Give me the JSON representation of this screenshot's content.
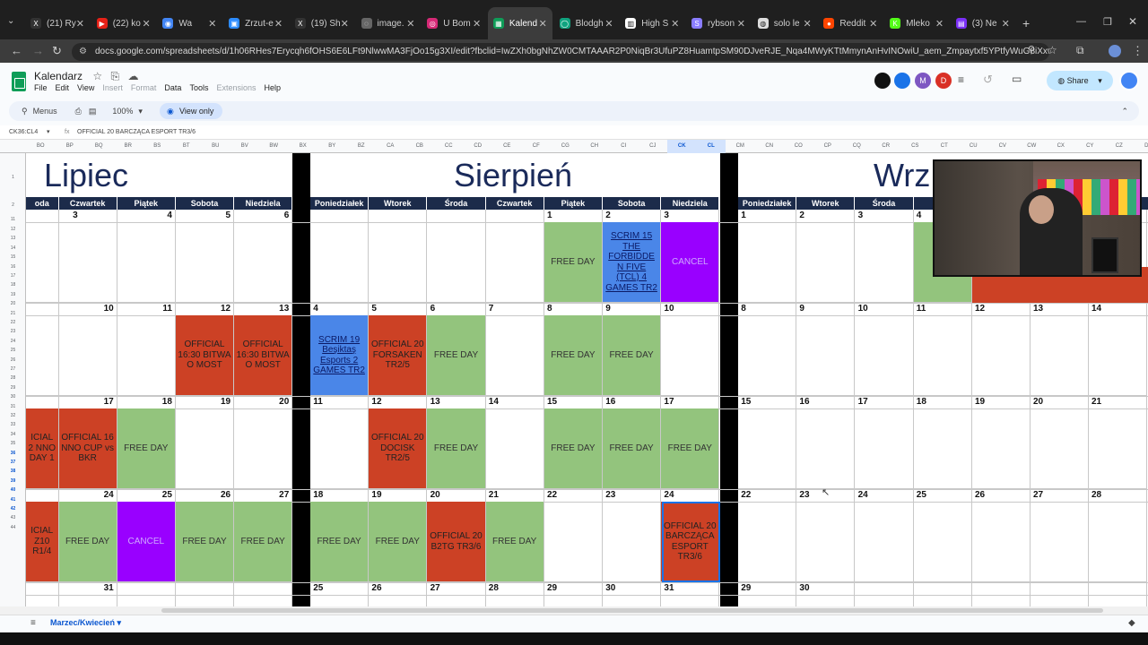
{
  "browser": {
    "tabs": [
      {
        "label": "(21) Ry",
        "color": "#333333",
        "glyph": "X"
      },
      {
        "label": "(22) ko",
        "color": "#e62117",
        "glyph": "▶"
      },
      {
        "label": "Wa",
        "color": "#4285f4",
        "glyph": "◉"
      },
      {
        "label": "Zrzut-e",
        "color": "#2d8cff",
        "glyph": "▣"
      },
      {
        "label": "(19) Sh",
        "color": "#333333",
        "glyph": "X"
      },
      {
        "label": "image.",
        "color": "#666666",
        "glyph": "◌"
      },
      {
        "label": "U Bom",
        "color": "#d62976",
        "glyph": "◎"
      },
      {
        "label": "Kalend",
        "color": "#0f9d58",
        "glyph": "▦",
        "active": true
      },
      {
        "label": "Blodgh",
        "color": "#10a37f",
        "glyph": "◯"
      },
      {
        "label": "High S",
        "color": "#ffffff",
        "glyph": "▥"
      },
      {
        "label": "rybson",
        "color": "#8a7dff",
        "glyph": "S"
      },
      {
        "label": "solo le",
        "color": "#dddddd",
        "glyph": "◍"
      },
      {
        "label": "Reddit",
        "color": "#ff4500",
        "glyph": "●"
      },
      {
        "label": "Mleko",
        "color": "#53fc18",
        "glyph": "K"
      },
      {
        "label": "(3) Ne",
        "color": "#7b2ff7",
        "glyph": "▤"
      }
    ],
    "url": "docs.google.com/spreadsheets/d/1h06RHes7Erycqh6fOHS6E6LFt9NlwwMA3FjOo15g3XI/edit?fbclid=IwZXh0bgNhZW0CMTAAAR2P0NiqBr3UfuPZ8HuamtpSM90DJveRJE_Nqa4MWyKTtMmynAnHvINOwiU_aem_Zmpaytxf5YPtfyWuG8iXxw&gid=11984..."
  },
  "sheets": {
    "title": "Kalendarz",
    "menu": [
      "File",
      "Edit",
      "View",
      "Insert",
      "Format",
      "Data",
      "Tools",
      "Extensions",
      "Help"
    ],
    "menu_dim": [
      false,
      false,
      false,
      true,
      true,
      false,
      false,
      true,
      false
    ],
    "menus_search": "Menus",
    "zoom": "100%",
    "view_only": "View only",
    "share": "Share",
    "avatars": [
      {
        "letter": "",
        "color": "#111111"
      },
      {
        "letter": "",
        "color": "#1a73e8"
      },
      {
        "letter": "M",
        "color": "#7e57c2"
      },
      {
        "letter": "D",
        "color": "#d93025"
      }
    ],
    "cell_ref": "CK36:CL4",
    "formula": "OFFICIAL 20 BARCZĄCA ESPORT TR3/6",
    "sheet_tab": "Marzec/Kwiecień"
  },
  "columns": [
    "BO",
    "BP",
    "BQ",
    "BR",
    "BS",
    "BT",
    "BU",
    "BV",
    "BW",
    "BX",
    "BY",
    "BZ",
    "CA",
    "CB",
    "CC",
    "CD",
    "CE",
    "CF",
    "CG",
    "CH",
    "CI",
    "CJ",
    "CK",
    "CL",
    "CM",
    "CN",
    "CO",
    "CP",
    "CQ",
    "CR",
    "CS",
    "CT",
    "CU",
    "CV",
    "CW",
    "CX",
    "CY",
    "CZ",
    "DA"
  ],
  "rows": [
    "1",
    "2",
    "11",
    "12",
    "13",
    "14",
    "15",
    "16",
    "17",
    "18",
    "19",
    "20",
    "21",
    "22",
    "23",
    "24",
    "25",
    "26",
    "27",
    "28",
    "29",
    "30",
    "31",
    "32",
    "33",
    "34",
    "35",
    "36",
    "37",
    "38",
    "39",
    "40",
    "41",
    "42",
    "43",
    "44"
  ],
  "calendar": {
    "months": [
      {
        "name": "Lipiec"
      },
      {
        "name": "Sierpień"
      },
      {
        "name": "Wrz"
      }
    ],
    "day_headers": [
      [
        "oda",
        "Czwartek",
        "Piątek",
        "Sobota",
        "Niedziela"
      ],
      [
        "Poniedziałek",
        "Wtorek",
        "Środa",
        "Czwartek",
        "Piątek",
        "Sobota",
        "Niedziela"
      ],
      [
        "Poniedziałek",
        "Wtorek",
        "Środa",
        "C"
      ]
    ],
    "weeks": [
      {
        "days": [
          [
            null,
            "3",
            "4",
            "5",
            "6"
          ],
          [
            "",
            "",
            "",
            "",
            "1",
            "2",
            "3"
          ],
          [
            "1",
            "2",
            "3",
            "4"
          ]
        ],
        "events": [
          [
            null,
            null,
            null,
            null,
            null
          ],
          [
            null,
            null,
            null,
            null,
            {
              "t": "FREE DAY",
              "c": "green"
            },
            {
              "t": "SCRIM 15 THE FORBIDDE N FIVE (TCL) 4 GAMES TR2",
              "c": "blue"
            },
            {
              "t": "CANCEL",
              "c": "purple"
            }
          ],
          [
            null,
            null,
            null,
            {
              "t": "FR",
              "c": "green"
            }
          ]
        ]
      },
      {
        "days": [
          [
            "",
            "10",
            "11",
            "12",
            "13"
          ],
          [
            "4",
            "5",
            "6",
            "7",
            "8",
            "9",
            "10"
          ],
          [
            "8",
            "9",
            "10",
            "11"
          ]
        ],
        "events": [
          [
            null,
            null,
            null,
            {
              "t": "OFFICIAL 16:30 BITWA O MOST",
              "c": "red"
            },
            {
              "t": "OFFICIAL 16:30 BITWA O MOST",
              "c": "red"
            }
          ],
          [
            {
              "t": "SCRIM 19 Beşiktaş Esports 2 GAMES TR2",
              "c": "blue"
            },
            {
              "t": "OFFICIAL 20 FORSAKEN TR2/5",
              "c": "red"
            },
            {
              "t": "FREE DAY",
              "c": "green"
            },
            null,
            {
              "t": "FREE DAY",
              "c": "green"
            },
            {
              "t": "FREE DAY",
              "c": "green"
            },
            null
          ],
          [
            null,
            null,
            null,
            null
          ]
        ]
      },
      {
        "days": [
          [
            "",
            "17",
            "18",
            "19",
            "20"
          ],
          [
            "11",
            "12",
            "13",
            "14",
            "15",
            "16",
            "17"
          ],
          [
            "15",
            "16",
            "17",
            "18"
          ]
        ],
        "events": [
          [
            {
              "t": "ICIAL 2 NNO DAY 1",
              "c": "red"
            },
            {
              "t": "OFFICIAL 16 NNO CUP vs BKR",
              "c": "red"
            },
            {
              "t": "FREE DAY",
              "c": "green"
            },
            null,
            null
          ],
          [
            null,
            {
              "t": "OFFICIAL 20 DOCISK TR2/5",
              "c": "red"
            },
            {
              "t": "FREE DAY",
              "c": "green"
            },
            null,
            {
              "t": "FREE DAY",
              "c": "green"
            },
            {
              "t": "FREE DAY",
              "c": "green"
            },
            {
              "t": "FREE DAY",
              "c": "green"
            }
          ],
          [
            null,
            null,
            null,
            null
          ]
        ]
      },
      {
        "days": [
          [
            "",
            "24",
            "25",
            "26",
            "27"
          ],
          [
            "18",
            "19",
            "20",
            "21",
            "22",
            "23",
            "24"
          ],
          [
            "22",
            "23",
            "24",
            "25"
          ]
        ],
        "events": [
          [
            {
              "t": "ICIAL Z10 R1/4",
              "c": "red"
            },
            {
              "t": "FREE DAY",
              "c": "green"
            },
            {
              "t": "CANCEL",
              "c": "purple"
            },
            {
              "t": "FREE DAY",
              "c": "green"
            },
            {
              "t": "FREE DAY",
              "c": "green"
            }
          ],
          [
            {
              "t": "FREE DAY",
              "c": "green"
            },
            {
              "t": "FREE DAY",
              "c": "green"
            },
            {
              "t": "OFFICIAL 20 B2TG TR3/6",
              "c": "red"
            },
            {
              "t": "FREE DAY",
              "c": "green"
            },
            null,
            null,
            {
              "t": "OFFICIAL 20 BARCZĄCA ESPORT TR3/6",
              "c": "red"
            }
          ],
          [
            null,
            null,
            null,
            null
          ]
        ]
      },
      {
        "days": [
          [
            "",
            "31",
            "",
            "",
            ""
          ],
          [
            "25",
            "26",
            "27",
            "28",
            "29",
            "30",
            "31"
          ],
          [
            "29",
            "30",
            "",
            ""
          ]
        ],
        "events": [
          [
            null,
            null,
            null,
            null,
            null
          ],
          [
            null,
            null,
            null,
            null,
            null,
            null,
            null
          ],
          [
            null,
            null,
            null,
            null
          ]
        ]
      }
    ],
    "extra_days_right": [
      [
        "",
        "",
        ""
      ],
      [
        "12",
        "13",
        "14"
      ],
      [
        "19",
        "20",
        "21"
      ],
      [
        "26",
        "27",
        "28"
      ],
      [
        "",
        "",
        ""
      ]
    ]
  }
}
